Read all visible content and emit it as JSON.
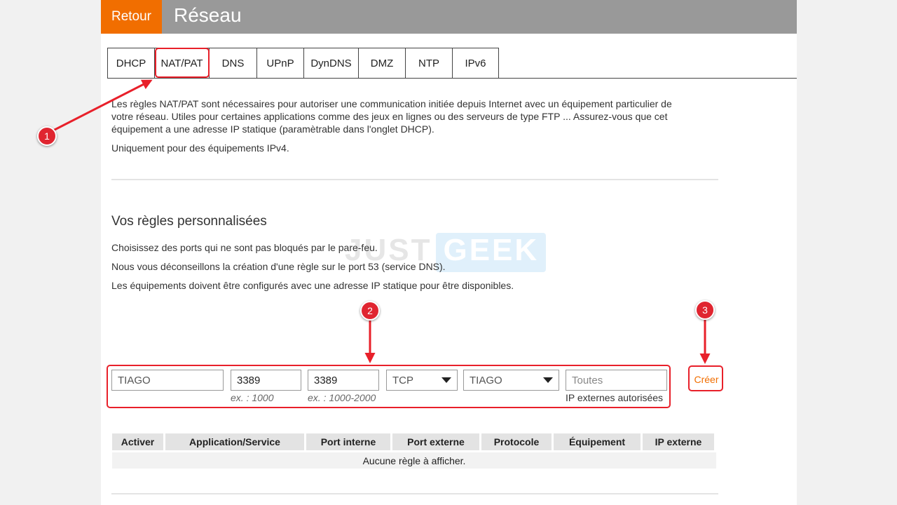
{
  "header": {
    "back_label": "Retour",
    "title": "Réseau"
  },
  "tabs": [
    {
      "label": "DHCP"
    },
    {
      "label": "NAT/PAT"
    },
    {
      "label": "DNS"
    },
    {
      "label": "UPnP"
    },
    {
      "label": "DynDNS"
    },
    {
      "label": "DMZ"
    },
    {
      "label": "NTP"
    },
    {
      "label": "IPv6"
    }
  ],
  "intro": {
    "line1": "Les règles NAT/PAT sont nécessaires pour autoriser une communication initiée depuis Internet avec un équipement particulier de",
    "line2": "votre réseau. Utiles pour certaines applications comme des jeux en lignes ou des serveurs de type FTP ... Assurez-vous que cet",
    "line3": "équipement a une adresse IP statique (paramètrable dans l'onglet DHCP).",
    "ipv4_note": "Uniquement pour des équipements IPv4."
  },
  "rules_section": {
    "title": "Vos règles personnalisées",
    "note1": "Choisissez des ports qui ne sont pas bloqués par le pare-feu.",
    "note2": "Nous vous déconseillons la création d'une règle sur le port 53 (service DNS).",
    "note3": "Les équipements doivent être configurés avec une adresse IP statique pour être disponibles."
  },
  "watermark": {
    "part1": "JUST",
    "part2": "GEEK"
  },
  "form": {
    "app_value": "TIAGO",
    "internal_port_value": "3389",
    "internal_port_hint": "ex. : 1000",
    "external_port_value": "3389",
    "external_port_hint": "ex. : 1000-2000",
    "protocol_value": "TCP",
    "device_value": "TIAGO",
    "external_ip_placeholder": "Toutes",
    "external_ip_hint": "IP externes autorisées",
    "create_label": "Créer"
  },
  "table": {
    "headers": [
      "Activer",
      "Application/Service",
      "Port interne",
      "Port externe",
      "Protocole",
      "Équipement",
      "IP externe"
    ],
    "empty_text": "Aucune règle à afficher."
  },
  "annotations": {
    "badge1": "1",
    "badge2": "2",
    "badge3": "3"
  },
  "colors": {
    "accent": "#f16e00",
    "annotation_red": "#e8202a",
    "header_gray": "#999999"
  }
}
